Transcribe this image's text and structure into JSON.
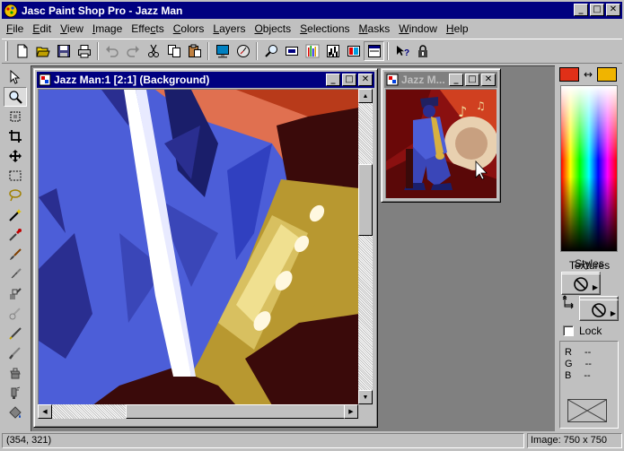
{
  "window": {
    "title": "Jasc Paint Shop Pro - Jazz Man"
  },
  "caption_buttons": {
    "minimize": "_",
    "maximize": "□",
    "close": "✕"
  },
  "menu": [
    "File",
    "Edit",
    "View",
    "Image",
    "Effects",
    "Colors",
    "Layers",
    "Objects",
    "Selections",
    "Masks",
    "Window",
    "Help"
  ],
  "menu_accel": [
    "F",
    "E",
    "V",
    "I",
    "c",
    "C",
    "L",
    "O",
    "S",
    "M",
    "W",
    "H"
  ],
  "toolbar_icons": [
    "new-icon",
    "open-icon",
    "save-icon",
    "print-icon",
    "undo-icon",
    "redo-icon",
    "cut-icon",
    "copy-icon",
    "paste-icon",
    "full-screen-preview-icon",
    "browse-icon",
    "zoom-icon",
    "overview-icon",
    "histogram-icon",
    "palette-icon",
    "layer-palette-icon",
    "toolbar-toggle-icon",
    "context-help-icon",
    "lock-icon"
  ],
  "tools": [
    "arrow-tool-icon",
    "zoom-tool-icon",
    "deformation-tool-icon",
    "crop-tool-icon",
    "mover-tool-icon",
    "selection-tool-icon",
    "freehand-selection-tool-icon",
    "magic-wand-tool-icon",
    "dropper-tool-icon",
    "paint-brush-tool-icon",
    "clone-brush-tool-icon",
    "color-replacer-tool-icon",
    "retouch-tool-icon",
    "scratch-remover-tool-icon",
    "eraser-tool-icon",
    "picture-tube-tool-icon",
    "airbrush-tool-icon",
    "flood-fill-tool-icon"
  ],
  "documents": [
    {
      "title": "Jazz Man:1 [2:1] (Background)",
      "active": true
    },
    {
      "title": "Jazz M...",
      "active": false
    }
  ],
  "colors": {
    "foreground": "#e03018",
    "background": "#f0b400",
    "canvas_blue": "#4c5ed8",
    "saxophone_gold": "#b89830",
    "dark_maroon": "#3a0a0a",
    "salmon": "#e07050"
  },
  "palette": {
    "swap_icon": "↔",
    "styles_label": "Styles",
    "textures_label": "Textures",
    "lock_label": "Lock",
    "lock_checked": false,
    "rgb": [
      {
        "label": "R",
        "value": "--"
      },
      {
        "label": "G",
        "value": "--"
      },
      {
        "label": "B",
        "value": "--"
      }
    ]
  },
  "status": {
    "coords": "(354, 321)",
    "image_info": "Image:  750 x 750"
  }
}
